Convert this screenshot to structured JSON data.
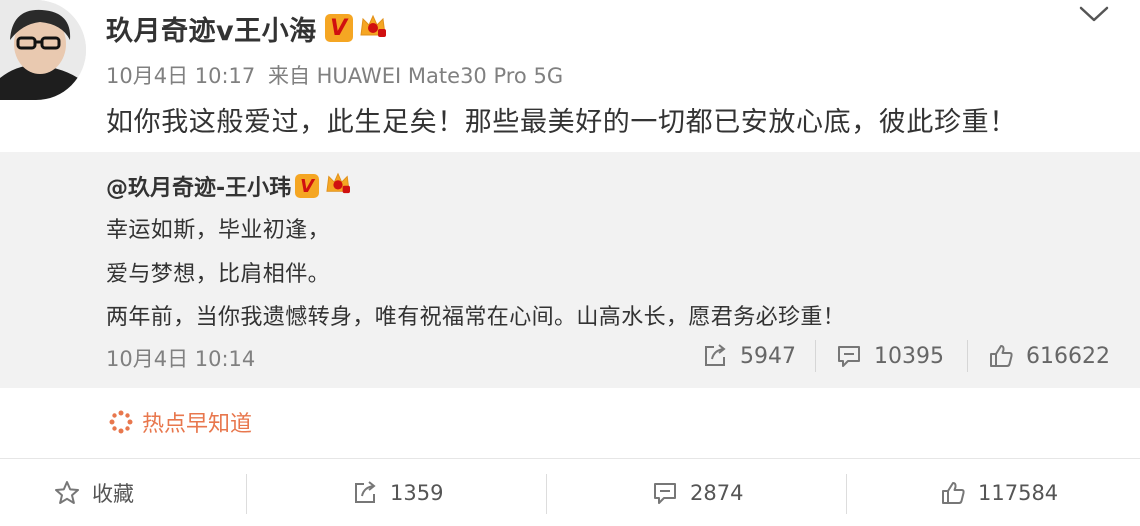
{
  "post": {
    "author": "玖月奇迹v王小海",
    "verified_badge": "V",
    "time": "10月4日 10:17",
    "source": "来自 HUAWEI Mate30 Pro 5G",
    "text": "如你我这般爱过，此生足矣！那些最美好的一切都已安放心底，彼此珍重！"
  },
  "quoted": {
    "author": "@玖月奇迹-王小玮",
    "verified_badge": "V",
    "lines": [
      "幸运如斯，毕业初逢，",
      "爱与梦想，比肩相伴。",
      "两年前，当你我遗憾转身，唯有祝福常在心间。山高水长，愿君务必珍重！"
    ],
    "time": "10月4日 10:14",
    "reposts": "5947",
    "comments": "10395",
    "likes": "616622"
  },
  "hot_topic": "热点早知道",
  "actions": {
    "favorite": "收藏",
    "reposts": "1359",
    "comments": "2874",
    "likes": "117584"
  },
  "colors": {
    "badge_bg": "#f5a623",
    "badge_text": "#d01010",
    "hot_topic": "#e8774d",
    "quote_bg": "#f2f2f2"
  },
  "icons": [
    "avatar",
    "verified-v-icon",
    "crown-icon",
    "chevron-down-icon",
    "repost-icon",
    "comment-icon",
    "like-icon",
    "hot-topic-icon",
    "star-icon"
  ]
}
